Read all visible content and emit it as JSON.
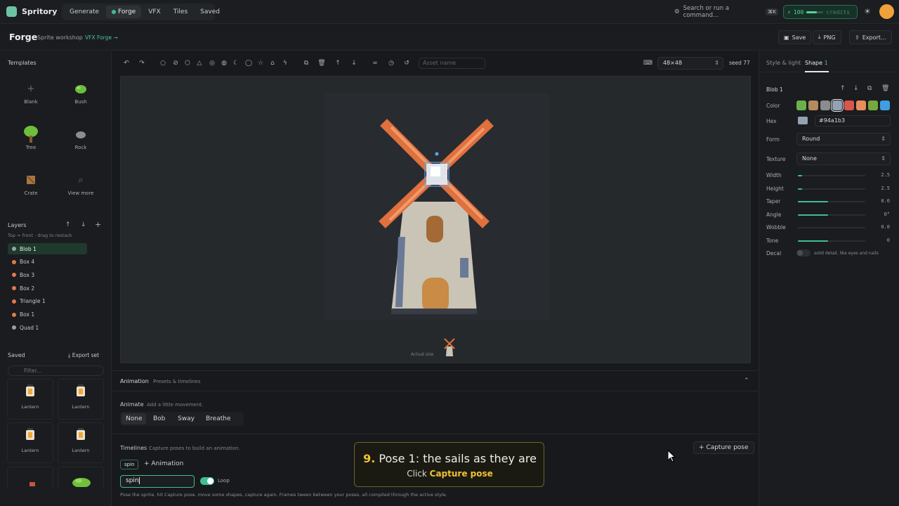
{
  "app": {
    "name": "Spritory"
  },
  "nav": {
    "tabs": [
      "Generate",
      "Forge",
      "VFX",
      "Tiles",
      "Saved"
    ],
    "active": "Forge"
  },
  "search": {
    "placeholder": "Search or run a command...",
    "shortcut": "⌘K"
  },
  "credits": {
    "amount": "100",
    "label": "credits",
    "level": 0.6
  },
  "page": {
    "title": "Forge",
    "subtitle": "Sprite workshop",
    "link": "VFX Forge →"
  },
  "actions": {
    "save": "Save",
    "png": "PNG",
    "export": "Export..."
  },
  "left": {
    "templates_title": "Templates",
    "templates": [
      "Blank",
      "Bush",
      "Tree",
      "Rock",
      "Crate",
      "View more"
    ],
    "layers_title": "Layers",
    "layers_hint": "Top = front · drag to restack",
    "layers": [
      {
        "name": "Blob 1",
        "color": "#94a1b3"
      },
      {
        "name": "Box 4",
        "color": "#e07a4a"
      },
      {
        "name": "Box 3",
        "color": "#e07a4a"
      },
      {
        "name": "Box 2",
        "color": "#e07a4a"
      },
      {
        "name": "Triangle 1",
        "color": "#e07a4a"
      },
      {
        "name": "Box 1",
        "color": "#e07a4a"
      },
      {
        "name": "Quad 1",
        "color": "#9aa0a6"
      }
    ],
    "saved_title": "Saved",
    "export_set": "Export set",
    "filter_placeholder": "Filter...",
    "saved": [
      "Lantern",
      "Lantern",
      "Lantern",
      "Lantern"
    ]
  },
  "toolbar": {
    "asset_placeholder": "Asset name",
    "size": "48×48",
    "seed": "seed 77"
  },
  "canvas": {
    "actual_size_label": "Actual size"
  },
  "right": {
    "tabs": [
      "Style & light",
      "Shape"
    ],
    "shape_count": "1",
    "shape_name": "Blob 1",
    "color_label": "Color",
    "swatches": [
      "#6bb04c",
      "#b58a5c",
      "#8a8c8e",
      "#94a1b3",
      "#d8574a",
      "#e88d5c",
      "#76a63d",
      "#3d9fe0"
    ],
    "hex_label": "Hex",
    "hex_value": "#94a1b3",
    "form_label": "Form",
    "form_value": "Round",
    "texture_label": "Texture",
    "texture_value": "None",
    "sliders": [
      {
        "label": "Width",
        "value": "2.5",
        "level": 0.06
      },
      {
        "label": "Height",
        "value": "2.5",
        "level": 0.06
      },
      {
        "label": "Taper",
        "value": "0.0",
        "level": 0.45
      },
      {
        "label": "Angle",
        "value": "0°",
        "level": 0.45
      },
      {
        "label": "Wobble",
        "value": "0.0",
        "level": 0
      },
      {
        "label": "Tone",
        "value": "0",
        "level": 0.45
      }
    ],
    "decal_label": "Decal",
    "decal_hint": "solid detail, like eyes and nails"
  },
  "animation": {
    "title": "Animation",
    "subtitle": "Presets & timelines",
    "animate_label": "Animate",
    "animate_hint": "Add a little movement.",
    "presets": [
      "None",
      "Bob",
      "Sway",
      "Breathe"
    ],
    "timelines_label": "Timelines",
    "timelines_hint": "Capture poses to build an animation.",
    "chip": "spin",
    "add_animation": "Animation",
    "name_value": "spin",
    "loop_label": "Loop",
    "capture_pose": "Capture pose",
    "footer": "Pose the sprite, hit Capture pose, move some shapes, capture again. Frames tween between your poses, all compiled through the active style."
  },
  "tooltip": {
    "number": "9.",
    "title": "Pose 1: the sails as they are",
    "sub_prefix": "Click",
    "sub_highlight": "Capture pose"
  }
}
